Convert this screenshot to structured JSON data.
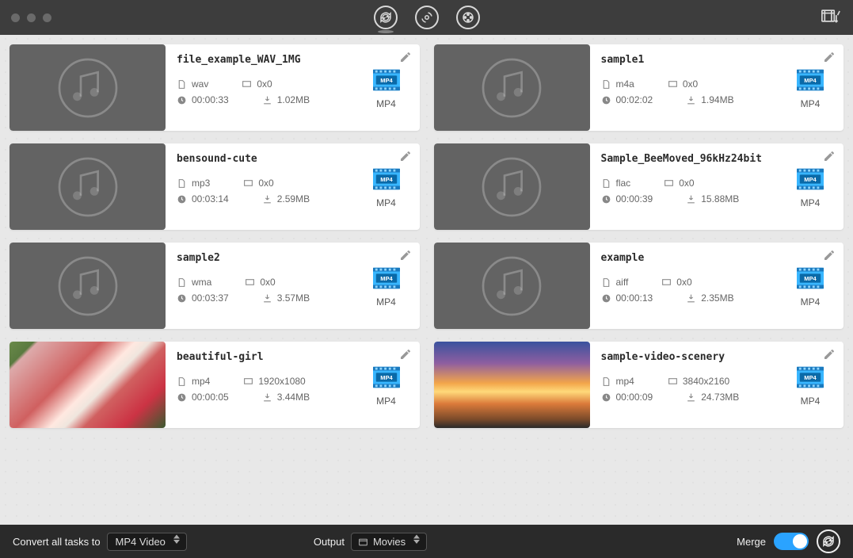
{
  "header": {
    "top_icons": [
      "convert-cycle",
      "disc",
      "reel"
    ],
    "right_icon": "library-icon"
  },
  "cards": [
    {
      "title": "file_example_WAV_1MG",
      "thumb": "audio",
      "ext": "wav",
      "res": "0x0",
      "dur": "00:00:33",
      "size": "1.02MB",
      "fmt": "MP4"
    },
    {
      "title": "sample1",
      "thumb": "audio",
      "ext": "m4a",
      "res": "0x0",
      "dur": "00:02:02",
      "size": "1.94MB",
      "fmt": "MP4"
    },
    {
      "title": "bensound-cute",
      "thumb": "audio",
      "ext": "mp3",
      "res": "0x0",
      "dur": "00:03:14",
      "size": "2.59MB",
      "fmt": "MP4"
    },
    {
      "title": "Sample_BeeMoved_96kHz24bit",
      "thumb": "audio",
      "ext": "flac",
      "res": "0x0",
      "dur": "00:00:39",
      "size": "15.88MB",
      "fmt": "MP4"
    },
    {
      "title": "sample2",
      "thumb": "audio",
      "ext": "wma",
      "res": "0x0",
      "dur": "00:03:37",
      "size": "3.57MB",
      "fmt": "MP4"
    },
    {
      "title": "example",
      "thumb": "audio",
      "ext": "aiff",
      "res": "0x0",
      "dur": "00:00:13",
      "size": "2.35MB",
      "fmt": "MP4"
    },
    {
      "title": "beautiful-girl",
      "thumb": "photo1",
      "ext": "mp4",
      "res": "1920x1080",
      "dur": "00:00:05",
      "size": "3.44MB",
      "fmt": "MP4"
    },
    {
      "title": "sample-video-scenery",
      "thumb": "photo2",
      "ext": "mp4",
      "res": "3840x2160",
      "dur": "00:00:09",
      "size": "24.73MB",
      "fmt": "MP4"
    }
  ],
  "footer": {
    "convert_label": "Convert all tasks to",
    "convert_select": "MP4 Video",
    "output_label": "Output",
    "output_select": "Movies",
    "merge_label": "Merge"
  }
}
